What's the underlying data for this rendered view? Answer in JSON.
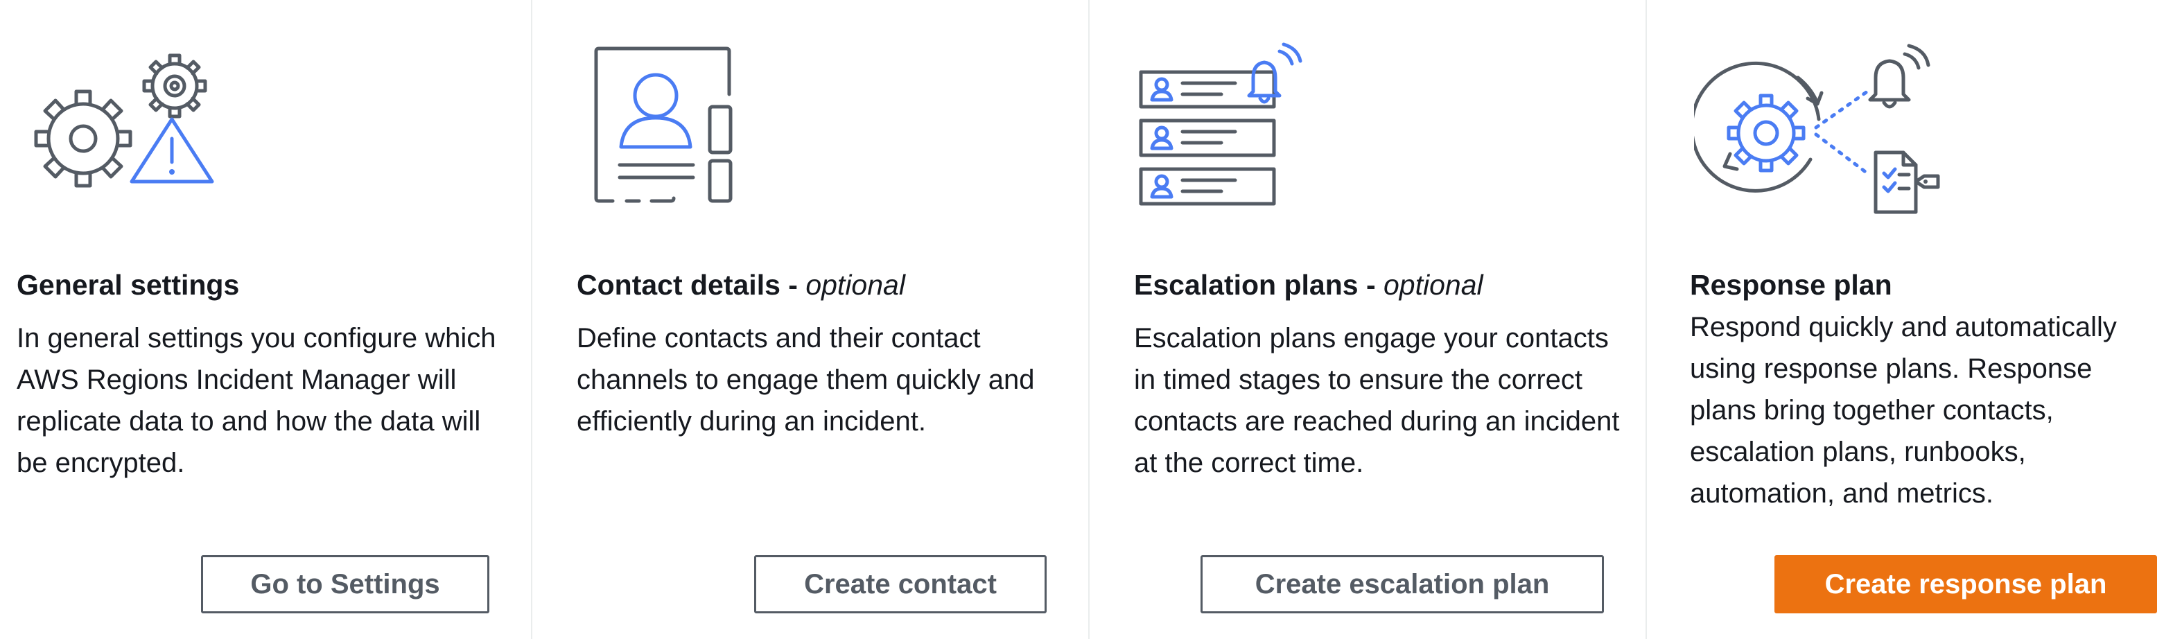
{
  "cards": [
    {
      "title": "General settings",
      "optional": "",
      "description": "In general settings you configure which AWS Regions Incident Manager will replicate data to and how the data will be encrypted.",
      "button": "Go to Settings",
      "icon": "gears-warning-icon"
    },
    {
      "title": "Contact details - ",
      "optional": "optional",
      "description": "Define contacts and their contact channels to engage them quickly and efficiently during an incident.",
      "button": "Create contact",
      "icon": "contact-book-icon"
    },
    {
      "title": "Escalation plans - ",
      "optional": "optional",
      "description": "Escalation plans engage your contacts in timed stages to ensure the correct contacts are reached during an incident at the correct time.",
      "button": "Create escalation plan",
      "icon": "escalation-list-icon"
    },
    {
      "title": "Response plan",
      "optional": "",
      "description": "Respond quickly and automatically using response plans. Response plans bring together contacts, escalation plans, runbooks, automation, and metrics.",
      "button": "Create response plan",
      "icon": "response-cycle-icon"
    }
  ],
  "colors": {
    "accent": "#ec7211",
    "icon_blue": "#4a7cf3",
    "icon_gray": "#545b64"
  }
}
